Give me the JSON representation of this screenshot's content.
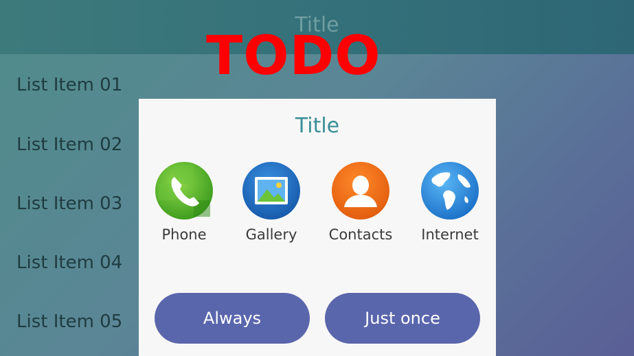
{
  "header": {
    "title": "Title"
  },
  "list": {
    "items": [
      {
        "label": "List Item 01"
      },
      {
        "label": "List Item 02"
      },
      {
        "label": "List Item 03"
      },
      {
        "label": "List Item 04"
      },
      {
        "label": "List Item 05"
      }
    ]
  },
  "overlay": {
    "todo_text": "TODO"
  },
  "popup": {
    "title": "Title",
    "apps": [
      {
        "label": "Phone",
        "icon": "phone-icon"
      },
      {
        "label": "Gallery",
        "icon": "gallery-icon"
      },
      {
        "label": "Contacts",
        "icon": "contacts-icon"
      },
      {
        "label": "Internet",
        "icon": "internet-icon"
      }
    ],
    "buttons": {
      "always": "Always",
      "just_once": "Just once"
    }
  },
  "colors": {
    "accent": "#3a8e97",
    "button": "#5a66ac",
    "todo": "#ff0000"
  }
}
